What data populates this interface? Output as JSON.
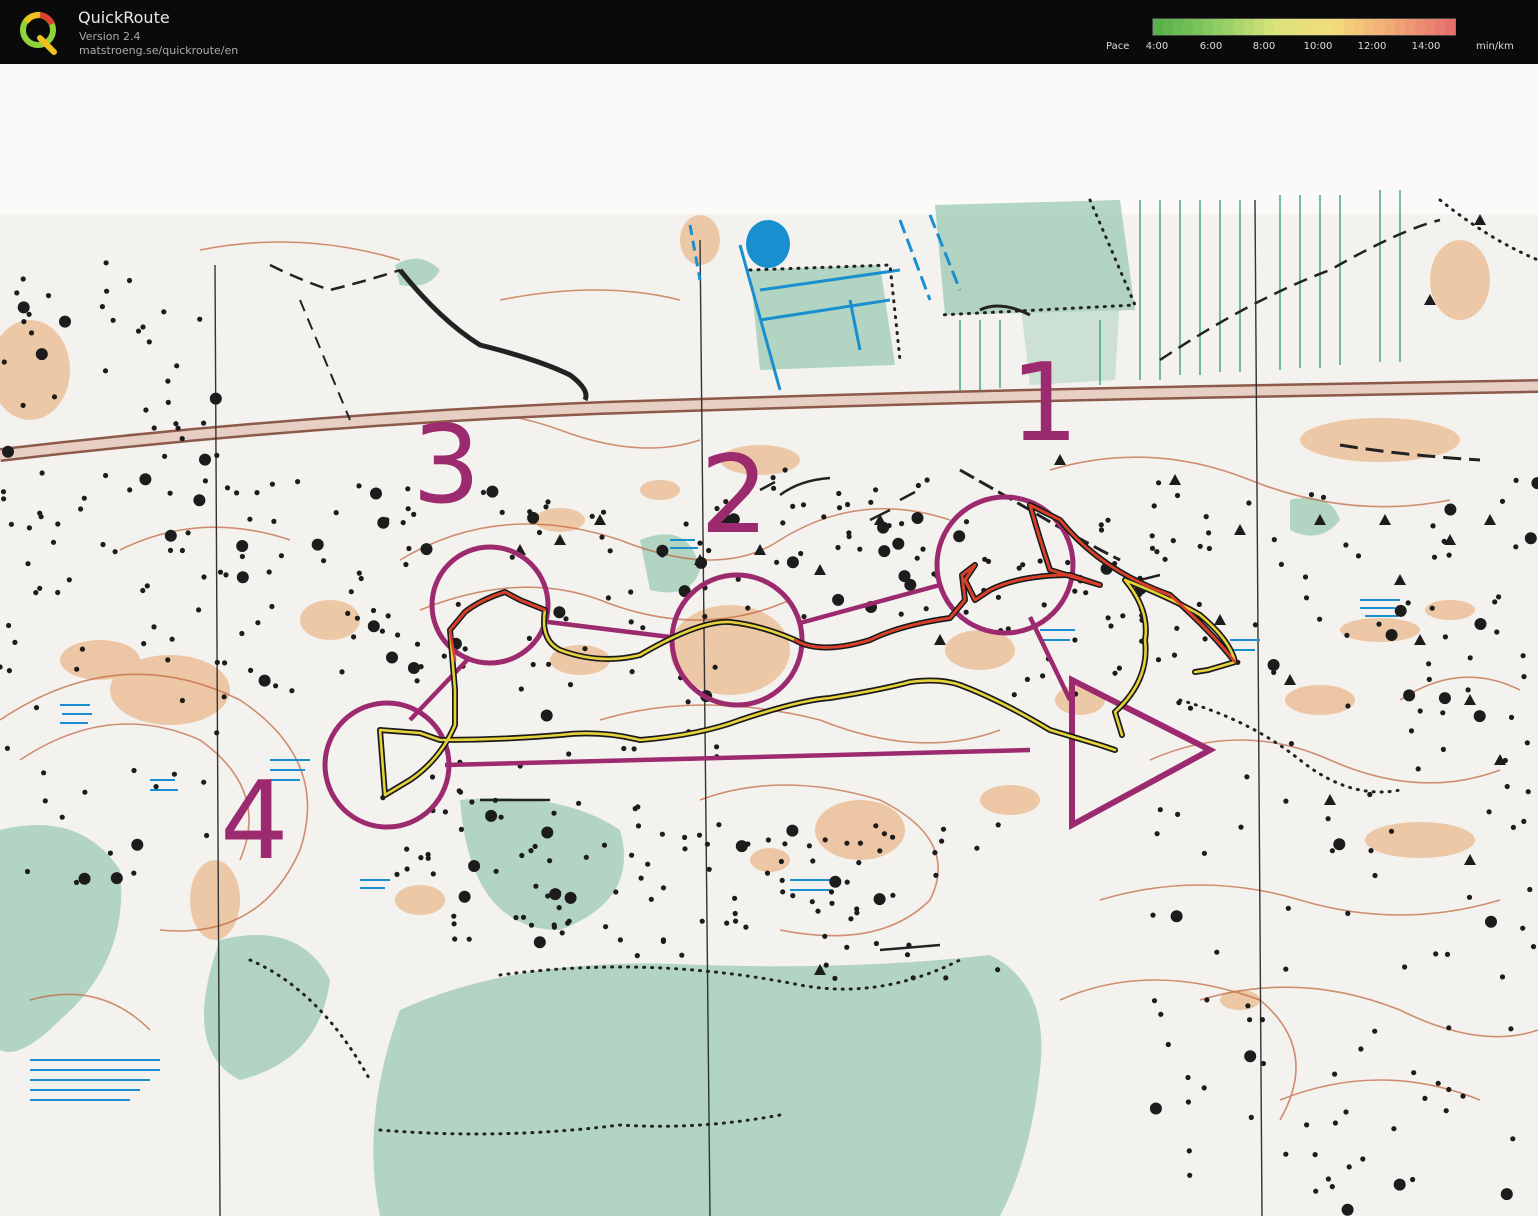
{
  "app": {
    "title": "QuickRoute",
    "version": "Version 2.4",
    "url": "matstroeng.se/quickroute/en"
  },
  "legend": {
    "label": "Pace",
    "unit": "min/km",
    "ticks": [
      "4:00",
      "6:00",
      "8:00",
      "10:00",
      "12:00",
      "14:00"
    ],
    "gradient_colors": [
      "#57b04a",
      "#8ccc62",
      "#d9e47a",
      "#f3dc7a",
      "#f0a878",
      "#e8706e"
    ]
  },
  "map": {
    "control_numbers": [
      "1",
      "2",
      "3",
      "4"
    ],
    "colors": {
      "course": "#9c2a6e",
      "route_slow": "#e03a2a",
      "route_medium": "#e6d23a",
      "vegetation": "#9cc9b3",
      "terrain": "#e8a56a",
      "water": "#1a8fd0"
    }
  }
}
